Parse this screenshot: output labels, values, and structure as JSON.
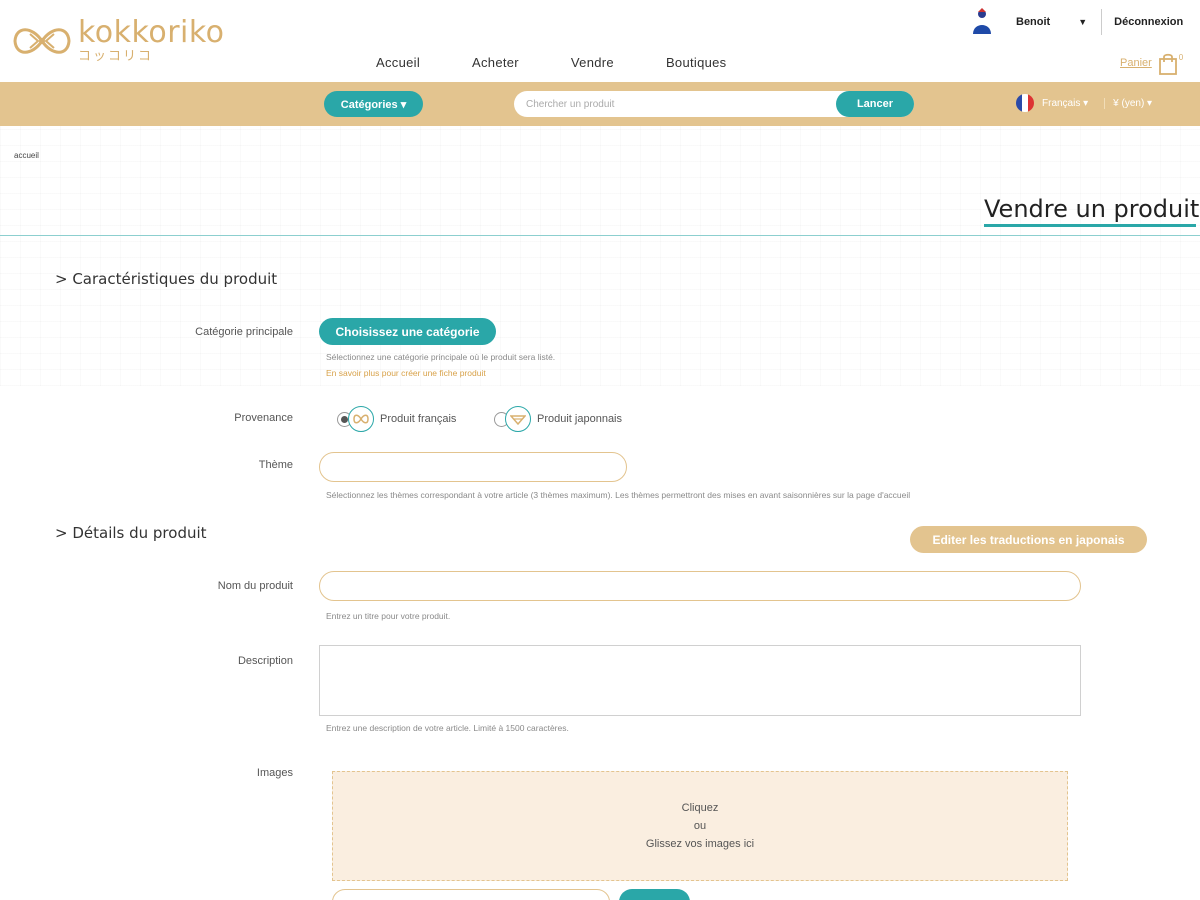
{
  "header": {
    "logo_word": "kokkoriko",
    "logo_kana": "コッコリコ",
    "user_name": "Benoit",
    "logout": "Déconnexion",
    "nav": [
      "Accueil",
      "Acheter",
      "Vendre",
      "Boutiques"
    ],
    "cart_label": "Panier",
    "cart_count": "0"
  },
  "searchbar": {
    "categories_label": "Catégories ▾",
    "search_placeholder": "Chercher un produit",
    "search_button": "Lancer",
    "language": "Français ▾",
    "currency": "¥ (yen) ▾"
  },
  "page": {
    "breadcrumb": "accueil",
    "title": "Vendre un produit"
  },
  "form": {
    "section1": "> Caractéristiques du produit",
    "category_label": "Catégorie principale",
    "category_button": "Choisissez une catégorie",
    "category_help": "Sélectionnez une catégorie principale où le produit sera listé.",
    "category_link": "En savoir plus pour créer une fiche produit",
    "provenance_label": "Provenance",
    "prov_fr": "Produit français",
    "prov_jp": "Produit japonnais",
    "theme_label": "Thème",
    "theme_help": "Sélectionnez les thèmes correspondant à votre article (3 thèmes maximum). Les thèmes permettront des mises en avant saisonnières sur la page d'accueil",
    "section2": "> Détails du produit",
    "translate_button": "Editer les traductions en japonais",
    "name_label": "Nom du produit",
    "name_help": "Entrez un titre pour votre produit.",
    "description_label": "Description",
    "description_help": "Entrez une description de votre article. Limité à 1500 caractères.",
    "images_label": "Images",
    "dropzone_line1": "Cliquez",
    "dropzone_line2": "ou",
    "dropzone_line3": "Glissez vos images ici"
  },
  "colors": {
    "accent_teal": "#2aa7a8",
    "gold": "#e3c48f",
    "gold_text": "#d8b06f"
  }
}
